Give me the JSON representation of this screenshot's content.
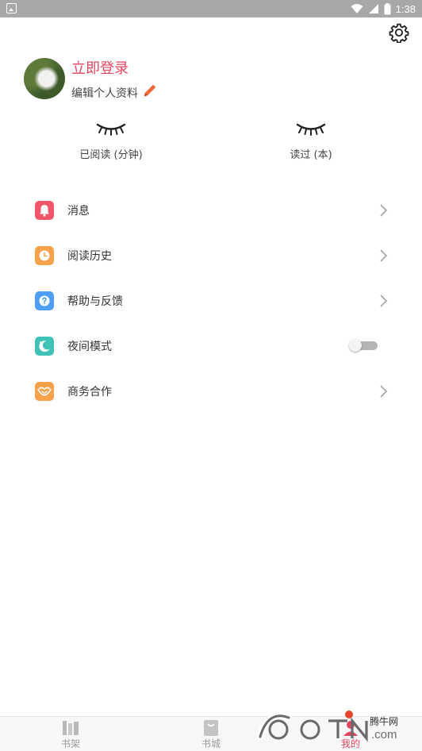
{
  "status_bar": {
    "time": "1:38"
  },
  "profile": {
    "login_text": "立即登录",
    "edit_text": "编辑个人资料"
  },
  "stats": [
    {
      "label": "已阅读 (分钟)"
    },
    {
      "label": "读过 (本)"
    }
  ],
  "menu": [
    {
      "label": "消息",
      "icon": "bell-icon",
      "color": "#f0556a"
    },
    {
      "label": "阅读历史",
      "icon": "clock-icon",
      "color": "#f8a14b"
    },
    {
      "label": "帮助与反馈",
      "icon": "help-icon",
      "color": "#4f9ef5"
    },
    {
      "label": "夜间模式",
      "icon": "moon-icon",
      "color": "#3ec3b6",
      "toggle": false
    },
    {
      "label": "商务合作",
      "icon": "handshake-icon",
      "color": "#f8a14b"
    }
  ],
  "bottom_nav": [
    {
      "label": "书架"
    },
    {
      "label": "书城"
    },
    {
      "label": "我的"
    }
  ],
  "watermark": {
    "text": "腾牛网",
    "logo": "QQTN.com"
  },
  "colors": {
    "accent": "#e4455f",
    "pencil": "#f06a3a"
  }
}
